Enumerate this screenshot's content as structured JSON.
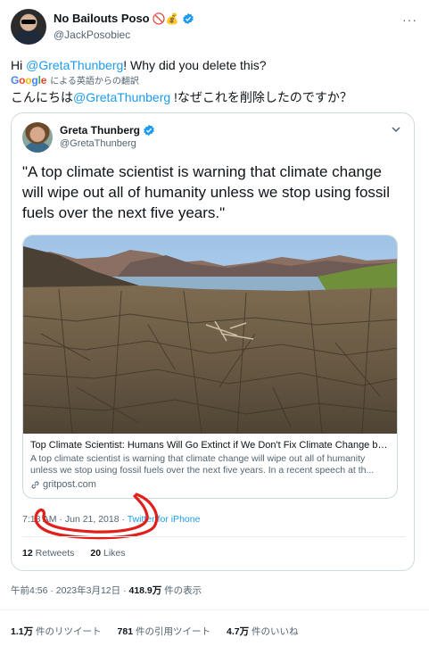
{
  "author": {
    "name": "No Bailouts Poso",
    "emoji_badges": "🚫💰",
    "handle": "@JackPosobiec",
    "more_icon": "ellipsis-icon"
  },
  "tweet": {
    "text_prefix": "Hi ",
    "text_mention": "@GretaThunberg",
    "text_suffix": "! Why did you delete this?",
    "translate_label": "による英語からの翻訳",
    "google": [
      "G",
      "o",
      "o",
      "g",
      "l",
      "e"
    ],
    "translated_prefix": "こんにちは",
    "translated_mention": "@GretaThunberg",
    "translated_suffix": " !なぜこれを削除したのですか？"
  },
  "quoted": {
    "name": "Greta Thunberg",
    "handle": "@GretaThunberg",
    "text": "\"A top climate scientist is warning that climate change will wipe out all of humanity unless we stop using fossil fuels over the next five years.\"",
    "link": {
      "title": "Top Climate Scientist: Humans Will Go Extinct if We Don't Fix Climate Change by ...",
      "description": "A top climate scientist is warning that climate change will wipe out all of humanity unless we stop using fossil fuels over the next five years. In a recent speech at th...",
      "domain": "gritpost.com"
    },
    "time": "7:18 AM · Jun 21, 2018 · ",
    "source": "Twitter for iPhone",
    "retweets_count": "12",
    "retweets_label": " Retweets",
    "likes_count": "20",
    "likes_label": " Likes"
  },
  "meta": {
    "timestamp": "午前4:56 · 2023年3月12日 · ",
    "views_count": "418.9万",
    "views_label": " 件の表示"
  },
  "stats": {
    "retweets_count": "1.1万",
    "retweets_label": " 件のリツイート",
    "quotes_count": "781",
    "quotes_label": " 件の引用ツイート",
    "likes_count": "4.7万",
    "likes_label": " 件のいいね"
  },
  "colors": {
    "accent": "#1d9bf0",
    "annotation": "#e0201b",
    "text": "#0f1419",
    "muted": "#536471"
  }
}
